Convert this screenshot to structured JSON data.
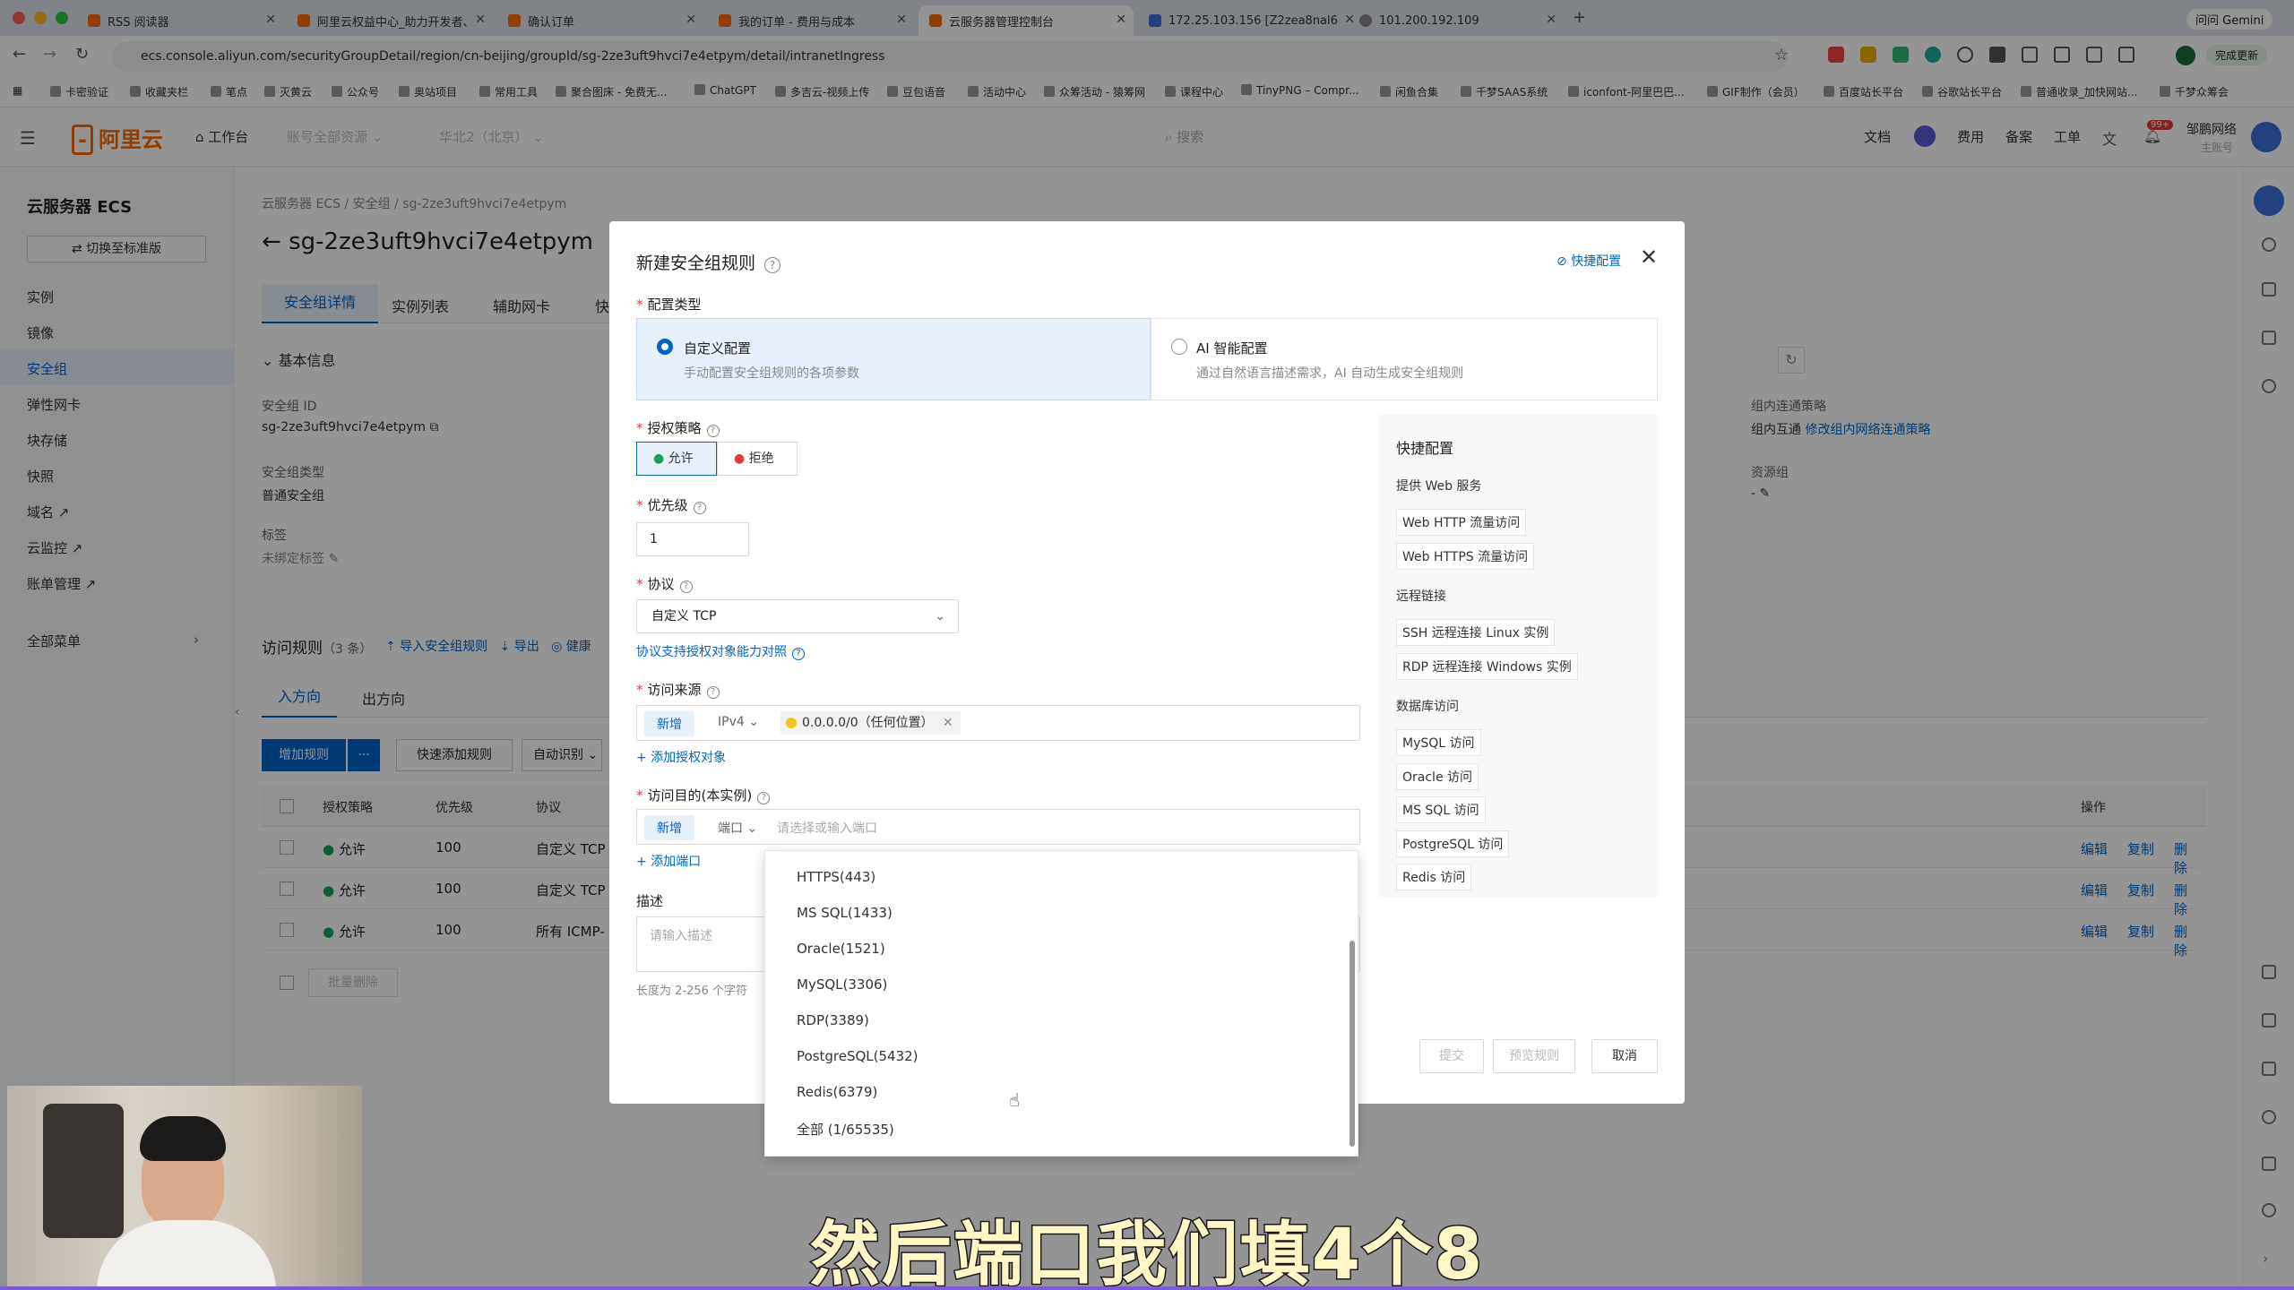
{
  "browser": {
    "tabs": [
      {
        "title": "RSS 阅读器"
      },
      {
        "title": "阿里云权益中心_助力开发者、"
      },
      {
        "title": "确认订单"
      },
      {
        "title": "我的订单 - 费用与成本"
      },
      {
        "title": "云服务器管理控制台"
      },
      {
        "title": "172.25.103.156 [Z2zea8nal6"
      },
      {
        "title": "101.200.192.109"
      }
    ],
    "url": "ecs.console.aliyun.com/securityGroupDetail/region/cn-beijing/groupId/sg-2ze3uft9hvci7e4etpym/detail/intranetIngress",
    "gemini": "问问 Gemini",
    "update_btn": "完成更新",
    "bookmarks": [
      "卡密验证",
      "收藏夹栏",
      "笔点",
      "灭黄云",
      "公众号",
      "奥站项目",
      "常用工具",
      "聚合图床 - 免费无...",
      "ChatGPT",
      "多吉云-视频上传",
      "豆包语音",
      "活动中心",
      "众筹活动 - 猿筹网",
      "课程中心",
      "TinyPNG – Compr...",
      "闲鱼合集",
      "千梦SAAS系统",
      "iconfont-阿里巴巴...",
      "GIF制作（会员）",
      "百度站长平台",
      "谷歌站长平台",
      "普通收录_加快网站...",
      "千梦众筹会"
    ]
  },
  "console": {
    "logo": "阿里云",
    "workbench": "工作台",
    "account_dd": "账号全部资源",
    "region_dd": "华北2（北京）",
    "search_ph": "搜索",
    "nav": [
      "文档",
      "费用",
      "备案",
      "工单"
    ],
    "user_name": "邹鹏网络",
    "user_sub": "主账号",
    "badge": "99+"
  },
  "sidebar": {
    "title": "云服务器 ECS",
    "switch": "切换至标准版",
    "items": [
      "实例",
      "镜像",
      "安全组",
      "弹性网卡",
      "块存储",
      "快照",
      "域名",
      "云监控",
      "账单管理"
    ],
    "all_menu": "全部菜单"
  },
  "page": {
    "breadcrumb": [
      "云服务器 ECS",
      "安全组",
      "sg-2ze3uft9hvci7e4etpym"
    ],
    "title": "sg-2ze3uft9hvci7e4etpym",
    "tabs": [
      "安全组详情",
      "实例列表",
      "辅助网卡",
      "快"
    ],
    "basic_info": "基本信息",
    "sg_id_label": "安全组 ID",
    "sg_id": "sg-2ze3uft9hvci7e4etpym",
    "sg_type_label": "安全组类型",
    "sg_type": "普通安全组",
    "tag_label": "标签",
    "tag_value": "未绑定标签",
    "intra_label": "组内连通策略",
    "intra_value": "组内互通",
    "intra_link": "修改组内网络连通策略",
    "rg_label": "资源组",
    "rg_value": "-",
    "rules_title": "访问规则",
    "rules_count": "（3 条）",
    "import_link": "导入安全组规则",
    "export_link": "导出",
    "health_link": "健康",
    "dir_tabs": [
      "入方向",
      "出方向"
    ],
    "add_rule_btn": "增加规则",
    "more_btn": "···",
    "quick_add_btn": "快速添加规则",
    "auto_btn": "自动识别",
    "columns": [
      "授权策略",
      "优先级",
      "协议",
      "操作"
    ],
    "rows": [
      {
        "policy": "允许",
        "priority": "100",
        "protocol": "自定义 TCP"
      },
      {
        "policy": "允许",
        "priority": "100",
        "protocol": "自定义 TCP"
      },
      {
        "policy": "允许",
        "priority": "100",
        "protocol": "所有 ICMP-"
      }
    ],
    "row_actions": [
      "编辑",
      "复制",
      "删除"
    ],
    "batch_delete": "批量删除"
  },
  "modal": {
    "title": "新建安全组规则",
    "quick_config_link": "快捷配置",
    "config_type_label": "配置类型",
    "custom_title": "自定义配置",
    "custom_desc": "手动配置安全组规则的各项参数",
    "ai_title": "AI 智能配置",
    "ai_desc": "通过自然语言描述需求，AI 自动生成安全组规则",
    "policy_label": "授权策略",
    "allow": "允许",
    "deny": "拒绝",
    "priority_label": "优先级",
    "priority_value": "1",
    "protocol_label": "协议",
    "protocol_value": "自定义 TCP",
    "protocol_link": "协议支持授权对象能力对照",
    "source_label": "访问来源",
    "new_tag": "新增",
    "ipv4": "IPv4",
    "source_chip": "0.0.0.0/0（任何位置）",
    "add_auth": "添加授权对象",
    "dest_label": "访问目的(本实例)",
    "port_sel": "端口",
    "port_placeholder": "请选择或输入端口",
    "add_port": "添加端口",
    "desc_label": "描述",
    "desc_placeholder": "请输入描述",
    "desc_hint": "长度为 2-256 个字符",
    "port_options": [
      "HTTPS(443)",
      "MS SQL(1433)",
      "Oracle(1521)",
      "MySQL(3306)",
      "RDP(3389)",
      "PostgreSQL(5432)",
      "Redis(6379)",
      "全部 (1/65535)"
    ],
    "quick_title": "快捷配置",
    "quick_groups": [
      {
        "name": "提供 Web 服务",
        "items": [
          "Web HTTP 流量访问",
          "Web HTTPS 流量访问"
        ]
      },
      {
        "name": "远程链接",
        "items": [
          "SSH 远程连接 Linux 实例",
          "RDP 远程连接 Windows 实例"
        ]
      },
      {
        "name": "数据库访问",
        "items": [
          "MySQL 访问",
          "Oracle 访问",
          "MS SQL 访问",
          "PostgreSQL 访问",
          "Redis 访问"
        ]
      }
    ],
    "submit": "提交",
    "preview": "预览规则",
    "cancel": "取消"
  },
  "subtitle": "然后端口我们填4个8"
}
